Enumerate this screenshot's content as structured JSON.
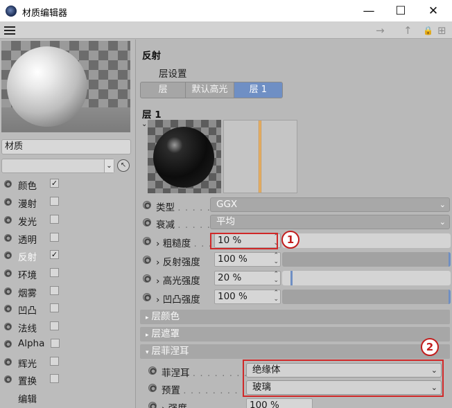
{
  "window": {
    "title": "材质编辑器",
    "minimize": "—",
    "maximize": "☐",
    "close": "✕"
  },
  "toolbar": {
    "back_icon": "→",
    "up_icon": "↑",
    "lock_icon": "🔒",
    "new_icon": "⊞"
  },
  "left": {
    "name_field": "材质",
    "channels": [
      {
        "label": "颜色",
        "checked": "✓"
      },
      {
        "label": "漫射",
        "checked": ""
      },
      {
        "label": "发光",
        "checked": ""
      },
      {
        "label": "透明",
        "checked": ""
      },
      {
        "label": "反射",
        "checked": "✓"
      },
      {
        "label": "环境",
        "checked": ""
      },
      {
        "label": "烟雾",
        "checked": ""
      },
      {
        "label": "凹凸",
        "checked": ""
      },
      {
        "label": "法线",
        "checked": ""
      },
      {
        "label": "Alpha",
        "checked": ""
      },
      {
        "label": "辉光",
        "checked": ""
      },
      {
        "label": "置换",
        "checked": ""
      },
      {
        "label": "编辑",
        "checked": ""
      }
    ]
  },
  "right": {
    "section_title": "反射",
    "layer_settings": "层设置",
    "tabs": [
      "层",
      "默认高光",
      "层 1"
    ],
    "layer_title": "层 1",
    "type": {
      "label": "类型",
      "dots": ". . . . .",
      "value": "GGX"
    },
    "attenuation": {
      "label": "衰减",
      "dots": ". . . . .",
      "value": "平均"
    },
    "roughness": {
      "label": "粗糙度",
      "dots": ". . .",
      "value": "10 %",
      "level": 0.1
    },
    "reflection_strength": {
      "label": "反射强度",
      "value": "100 %",
      "level": 1.0
    },
    "specular_strength": {
      "label": "高光强度",
      "value": "20 %",
      "level": 0.2
    },
    "bump_strength": {
      "label": "凹凸强度",
      "value": "100 %",
      "level": 1.0
    },
    "groups": {
      "layer_color": "层颜色",
      "layer_mask": "层遮罩",
      "layer_fresnel": "层菲涅耳"
    },
    "fresnel": {
      "label": "菲涅耳",
      "dots": ". . . . . . . .",
      "value": "绝缘体"
    },
    "preset": {
      "label": "预置",
      "dots": ". . . . . . . . . .",
      "value": "玻璃"
    },
    "strength": {
      "label": "强度",
      "value": "100 %"
    }
  },
  "annotations": {
    "badge1": "1",
    "badge2": "2"
  },
  "colors": {
    "accent": "#6f8fc4",
    "highlight": "#d02828"
  }
}
